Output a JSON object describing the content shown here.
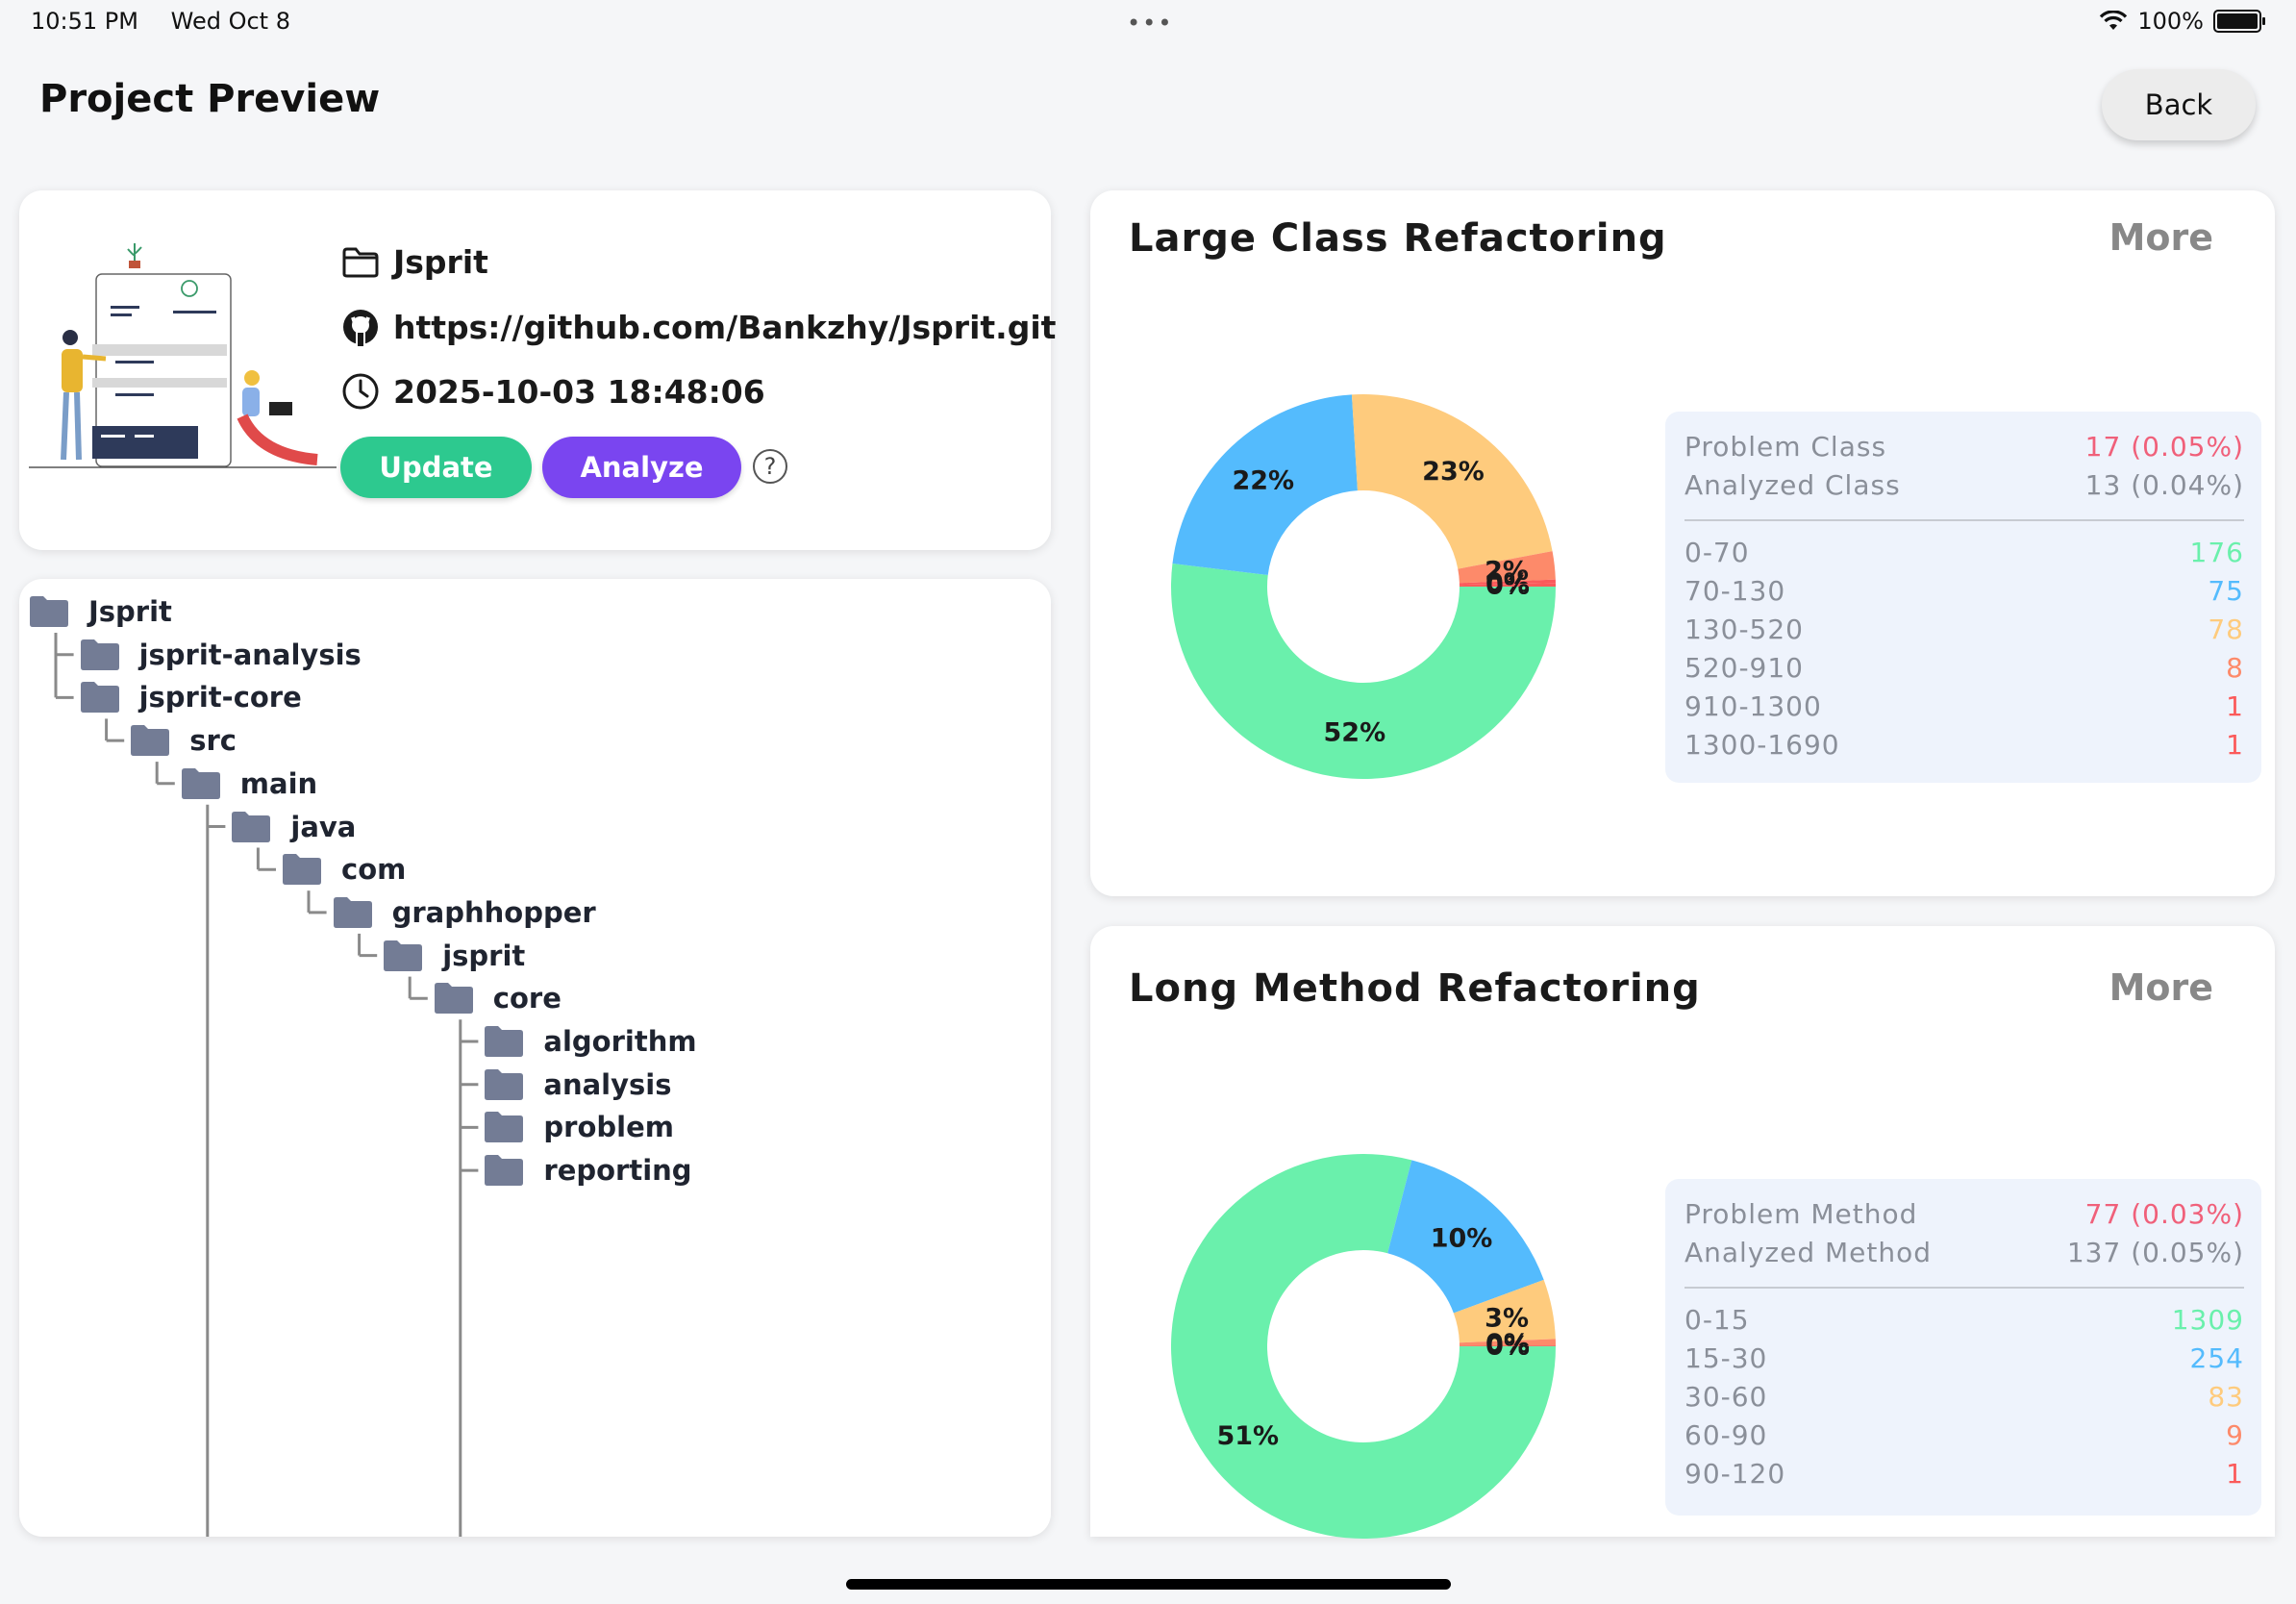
{
  "status_bar": {
    "time": "10:51 PM",
    "date": "Wed Oct 8",
    "dots": "•••",
    "battery": "100%"
  },
  "header": {
    "title": "Project Preview",
    "back_label": "Back"
  },
  "project": {
    "name": "Jsprit",
    "url": "https://github.com/Bankzhy/Jsprit.git",
    "datetime": "2025-10-03 18:48:06",
    "update_label": "Update",
    "analyze_label": "Analyze",
    "help_label": "?"
  },
  "tree": [
    {
      "label": "Jsprit",
      "depth": 0
    },
    {
      "label": "jsprit-analysis",
      "depth": 1
    },
    {
      "label": "jsprit-core",
      "depth": 1
    },
    {
      "label": "src",
      "depth": 2
    },
    {
      "label": "main",
      "depth": 3
    },
    {
      "label": "java",
      "depth": 4
    },
    {
      "label": "com",
      "depth": 5
    },
    {
      "label": "graphhopper",
      "depth": 6
    },
    {
      "label": "jsprit",
      "depth": 7
    },
    {
      "label": "core",
      "depth": 8
    },
    {
      "label": "algorithm",
      "depth": 9
    },
    {
      "label": "analysis",
      "depth": 9
    },
    {
      "label": "problem",
      "depth": 9
    },
    {
      "label": "reporting",
      "depth": 9
    }
  ],
  "colors": {
    "green": "#6af0ac",
    "blue": "#54bbfd",
    "orange": "#fecb7d",
    "coral": "#fd8a6a",
    "red": "#fb5a5a",
    "problem_pink": "#f0607a",
    "folder": "#737c95"
  },
  "chart_data": [
    {
      "type": "pie",
      "title": "Large Class Refactoring",
      "more_label": "More",
      "categories": [
        "0-70",
        "70-130",
        "130-520",
        "520-910",
        "910-1300",
        "1300-1690"
      ],
      "values": [
        176,
        75,
        78,
        8,
        1,
        1
      ],
      "slice_labels": [
        "52%",
        "22%",
        "23%",
        "2%",
        "0%",
        "0%"
      ],
      "colors": [
        "#6af0ac",
        "#54bbfd",
        "#fecb7d",
        "#fd8a6a",
        "#fb5a5a",
        "#fb5a5a"
      ],
      "summary": [
        {
          "label": "Problem Class",
          "value": "17 (0.05%)",
          "color": "#f0607a"
        },
        {
          "label": "Analyzed Class",
          "value": "13 (0.04%)",
          "color": "#8a8f99"
        }
      ],
      "value_colors": [
        "#6af0ac",
        "#54bbfd",
        "#fecb7d",
        "#fd8a6a",
        "#fb5a5a",
        "#fb5a5a"
      ]
    },
    {
      "type": "pie",
      "title": "Long Method Refactoring",
      "more_label": "More",
      "categories": [
        "0-15",
        "15-30",
        "30-60",
        "60-90",
        "90-120"
      ],
      "values": [
        1309,
        254,
        83,
        9,
        1
      ],
      "slice_labels": [
        "51%",
        "10%",
        "3%",
        "0%",
        "0%"
      ],
      "colors": [
        "#6af0ac",
        "#54bbfd",
        "#fecb7d",
        "#fd8a6a",
        "#fb5a5a"
      ],
      "summary": [
        {
          "label": "Problem Method",
          "value": "77 (0.03%)",
          "color": "#f0607a"
        },
        {
          "label": "Analyzed Method",
          "value": "137 (0.05%)",
          "color": "#8a8f99"
        }
      ],
      "value_colors": [
        "#6af0ac",
        "#54bbfd",
        "#fecb7d",
        "#fd8a6a",
        "#fb5a5a"
      ]
    }
  ]
}
